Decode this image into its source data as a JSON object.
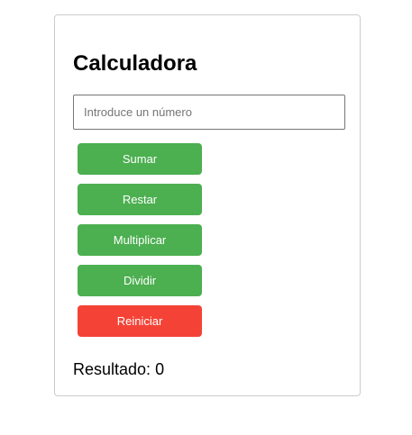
{
  "calculator": {
    "title": "Calculadora",
    "input": {
      "placeholder": "Introduce un número",
      "value": ""
    },
    "buttons": {
      "add": "Sumar",
      "subtract": "Restar",
      "multiply": "Multiplicar",
      "divide": "Dividir",
      "reset": "Reiniciar"
    },
    "result": {
      "label": "Resultado:",
      "value": "0"
    }
  },
  "colors": {
    "operation_button": "#4caf50",
    "reset_button": "#f44336",
    "card_border": "#cccccc"
  }
}
